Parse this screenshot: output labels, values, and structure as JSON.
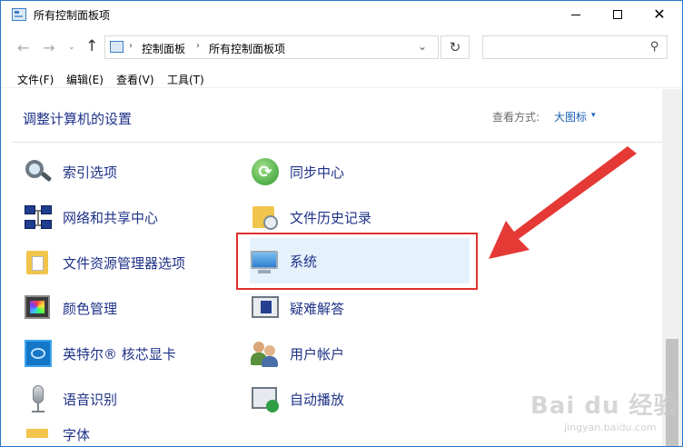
{
  "window": {
    "title": "所有控制面板项",
    "min_icon": "minimize-icon",
    "max_icon": "maximize-icon",
    "close_symbol": "✕"
  },
  "nav": {
    "back_symbol": "←",
    "forward_symbol": "→",
    "dropdown_symbol": "⌄",
    "up_symbol": "↑",
    "refresh_symbol": "↻",
    "search_symbol": "⚲",
    "breadcrumb": [
      "控制面板",
      "所有控制面板项"
    ],
    "crumb_separator": "›",
    "address_dropdown_symbol": "⌄",
    "search_placeholder": ""
  },
  "menu": [
    "文件(F)",
    "编辑(E)",
    "查看(V)",
    "工具(T)"
  ],
  "content": {
    "heading": "调整计算机的设置",
    "view_by_label": "查看方式:",
    "view_by_value": "大图标",
    "view_by_caret": "▾"
  },
  "items_left": [
    {
      "label": "索引选项",
      "icon": "indexing-search-icon"
    },
    {
      "label": "网络和共享中心",
      "icon": "network-icon"
    },
    {
      "label": "文件资源管理器选项",
      "icon": "folder-options-icon"
    },
    {
      "label": "颜色管理",
      "icon": "color-management-icon"
    },
    {
      "label": "英特尔® 核芯显卡",
      "icon": "intel-graphics-icon"
    },
    {
      "label": "语音识别",
      "icon": "microphone-icon"
    },
    {
      "label": "字体",
      "icon": "font-folder-icon"
    }
  ],
  "items_right": [
    {
      "label": "同步中心",
      "icon": "sync-icon"
    },
    {
      "label": "文件历史记录",
      "icon": "file-history-icon"
    },
    {
      "label": "系统",
      "icon": "system-monitor-icon",
      "selected": true
    },
    {
      "label": "疑难解答",
      "icon": "troubleshooting-icon"
    },
    {
      "label": "用户帐户",
      "icon": "user-accounts-icon"
    },
    {
      "label": "自动播放",
      "icon": "autoplay-icon"
    }
  ],
  "annotation": {
    "highlight_color": "#e0302e",
    "arrow_color": "#e53935"
  },
  "watermark": {
    "text": "Bai du 经验",
    "sub": "jingyan.baidu.com"
  }
}
